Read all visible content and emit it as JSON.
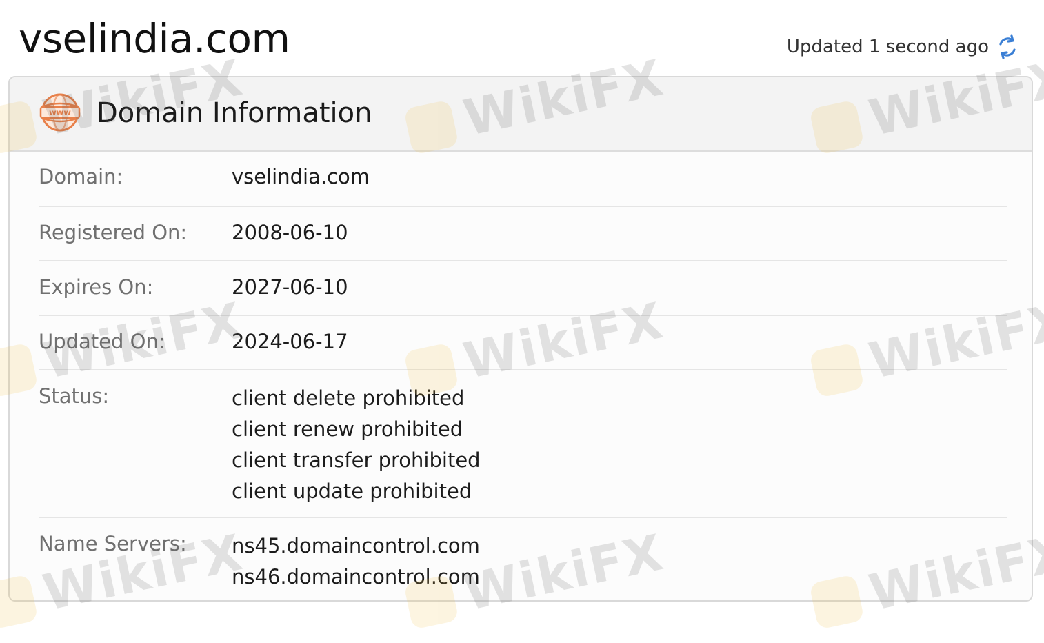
{
  "page": {
    "domain_title": "vselindia.com",
    "updated_text": "Updated 1 second ago"
  },
  "card": {
    "title": "Domain Information",
    "rows": [
      {
        "label": "Domain:",
        "values": [
          "vselindia.com"
        ]
      },
      {
        "label": "Registered On:",
        "values": [
          "2008-06-10"
        ]
      },
      {
        "label": "Expires On:",
        "values": [
          "2027-06-10"
        ]
      },
      {
        "label": "Updated On:",
        "values": [
          "2024-06-17"
        ]
      },
      {
        "label": "Status:",
        "values": [
          "client delete prohibited",
          "client renew prohibited",
          "client transfer prohibited",
          "client update prohibited"
        ]
      },
      {
        "label": "Name Servers:",
        "values": [
          "ns45.domaincontrol.com",
          "ns46.domaincontrol.com"
        ]
      }
    ]
  },
  "icons": {
    "refresh": "refresh-icon",
    "www": "www-globe-icon"
  },
  "watermark": {
    "text": "WikiFX"
  },
  "colors": {
    "accent_orange": "#e8804a",
    "refresh_blue": "#3a7fd5",
    "label_gray": "#707070"
  }
}
